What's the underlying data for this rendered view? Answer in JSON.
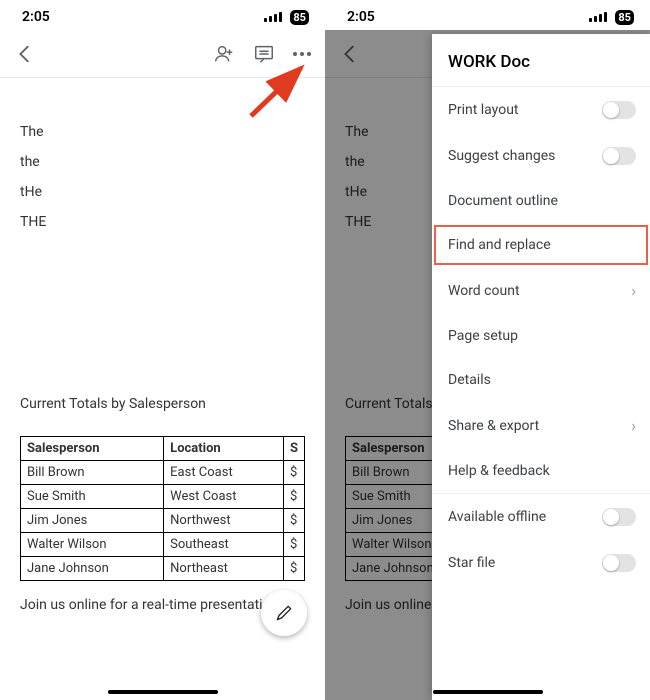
{
  "status": {
    "time": "2:05",
    "battery": "85"
  },
  "doc": {
    "words": [
      "The",
      "the",
      "tHe",
      "THE"
    ],
    "section_heading": "Current Totals by Salesperson",
    "section_heading_truncated": "Current Totals b",
    "table": {
      "headers": [
        "Salesperson",
        "Location",
        "S"
      ],
      "rows": [
        [
          "Bill Brown",
          "East Coast",
          "$"
        ],
        [
          "Sue Smith",
          "West Coast",
          "$"
        ],
        [
          "Jim Jones",
          "Northwest",
          "$"
        ],
        [
          "Walter Wilson",
          "Southeast",
          "$"
        ],
        [
          "Jane Johnson",
          "Northeast",
          "$"
        ]
      ]
    },
    "footer": "Join us online for a real-time presentation.",
    "footer_truncated": "Join us online fo"
  },
  "menu": {
    "title": "WORK Doc",
    "items": {
      "print_layout": "Print layout",
      "suggest_changes": "Suggest changes",
      "document_outline": "Document outline",
      "find_replace": "Find and replace",
      "word_count": "Word count",
      "page_setup": "Page setup",
      "details": "Details",
      "share_export": "Share & export",
      "help_feedback": "Help & feedback",
      "available_offline": "Available offline",
      "star_file": "Star file"
    }
  }
}
